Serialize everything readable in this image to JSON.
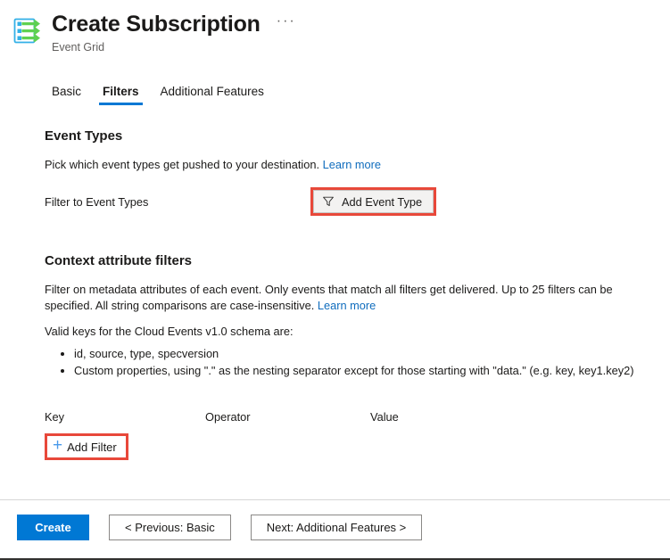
{
  "header": {
    "icon_name": "event-grid-icon",
    "title": "Create Subscription",
    "subtitle": "Event Grid",
    "more_label": "···",
    "accent_color": "#0078d4"
  },
  "tabs": [
    {
      "label": "Basic",
      "active": false
    },
    {
      "label": "Filters",
      "active": true
    },
    {
      "label": "Additional Features",
      "active": false
    }
  ],
  "event_types": {
    "heading": "Event Types",
    "description": "Pick which event types get pushed to your destination.",
    "learn_more": "Learn more",
    "filter_label": "Filter to Event Types",
    "add_button": "Add Event Type",
    "add_button_icon": "filter-funnel-icon",
    "highlight_color": "#e8483a"
  },
  "context_filters": {
    "heading": "Context attribute filters",
    "description": "Filter on metadata attributes of each event. Only events that match all filters get delivered. Up to 25 filters can be specified. All string comparisons are case-insensitive.",
    "learn_more": "Learn more",
    "valid_keys_intro": "Valid keys for the Cloud Events v1.0 schema are:",
    "valid_keys": [
      "id, source, type, specversion",
      "Custom properties, using \".\" as the nesting separator except for those starting with \"data.\" (e.g. key, key1.key2)"
    ],
    "columns": {
      "key": "Key",
      "operator": "Operator",
      "value": "Value"
    },
    "add_filter_label": "Add Filter",
    "add_filter_icon": "plus-icon",
    "highlight_color": "#e8483a"
  },
  "footer": {
    "create": "Create",
    "previous": "< Previous: Basic",
    "next": "Next: Additional Features >"
  }
}
